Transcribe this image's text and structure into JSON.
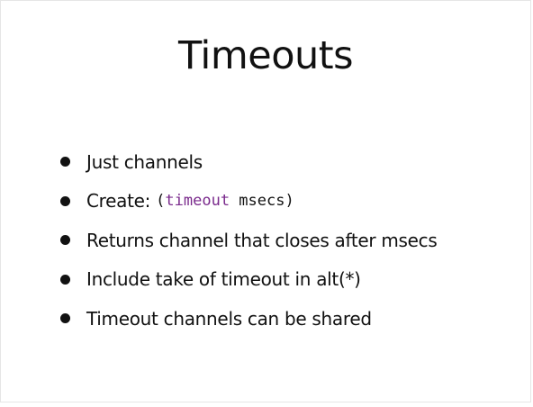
{
  "slide": {
    "title": "Timeouts",
    "bullets": [
      {
        "text": "Just channels"
      },
      {
        "text": "Create: ",
        "code": {
          "open": "(",
          "keyword": "timeout",
          "arg": " msecs",
          "close": ")"
        }
      },
      {
        "text": "Returns channel that closes after msecs"
      },
      {
        "text": "Include take of timeout in alt(*)"
      },
      {
        "text": "Timeout channels can be shared"
      }
    ]
  },
  "colors": {
    "text": "#111111",
    "code_keyword": "#7a2a8c",
    "background": "#ffffff"
  }
}
